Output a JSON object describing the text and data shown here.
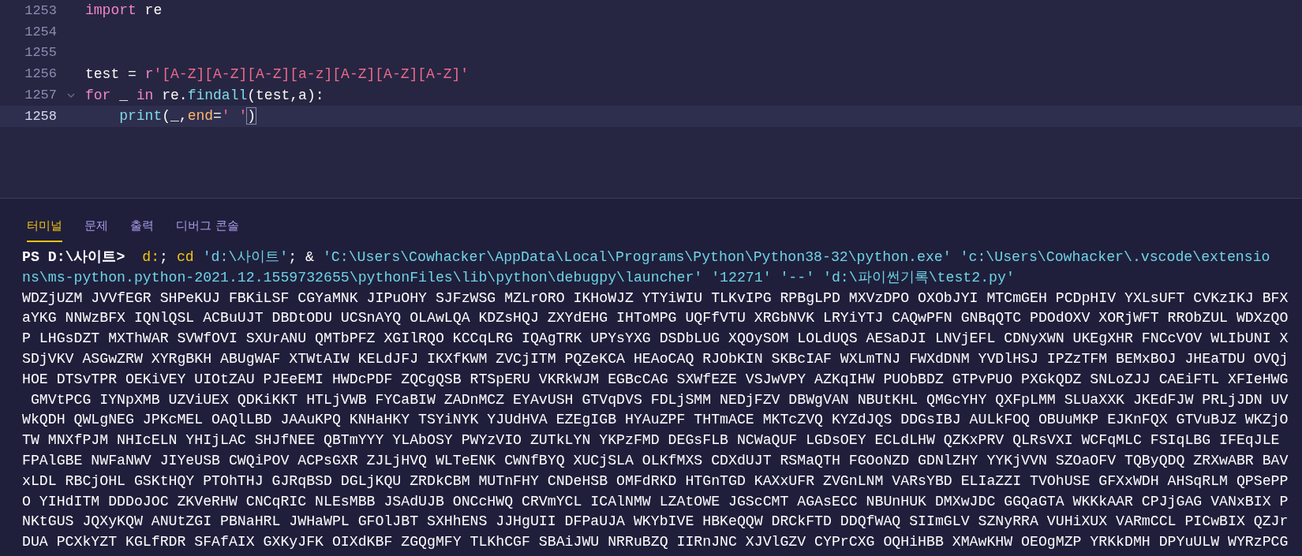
{
  "editor": {
    "lines": [
      {
        "number": "1253",
        "current": false,
        "tokens": [
          {
            "kind": "keyword",
            "text": "import"
          },
          {
            "kind": "plain",
            "text": " re"
          }
        ]
      },
      {
        "number": "1254",
        "current": false
      },
      {
        "number": "1255",
        "current": false
      },
      {
        "number": "1256",
        "current": false,
        "tokens": [
          {
            "kind": "plain",
            "text": "test = "
          },
          {
            "kind": "keyword",
            "text": "r"
          },
          {
            "kind": "string",
            "text": "'[A-Z][A-Z][A-Z][a-z][A-Z][A-Z][A-Z]'"
          }
        ]
      },
      {
        "number": "1257",
        "current": false,
        "foldable": true,
        "tokens": [
          {
            "kind": "keyword",
            "text": "for"
          },
          {
            "kind": "plain",
            "text": " _ "
          },
          {
            "kind": "keyword",
            "text": "in"
          },
          {
            "kind": "plain",
            "text": " re."
          },
          {
            "kind": "function",
            "text": "findall"
          },
          {
            "kind": "plain",
            "text": "(test,a):"
          }
        ]
      },
      {
        "number": "1258",
        "current": true,
        "indented": true,
        "tokens": [
          {
            "kind": "function",
            "text": "print"
          },
          {
            "kind": "plain",
            "text": "(_,"
          },
          {
            "kind": "param",
            "text": "end"
          },
          {
            "kind": "plain",
            "text": "="
          },
          {
            "kind": "string",
            "text": "' '"
          },
          {
            "kind": "match",
            "text": ")"
          }
        ]
      }
    ]
  },
  "panel": {
    "tabs": [
      {
        "label": "터미널",
        "selected": true
      },
      {
        "label": "문제",
        "selected": false
      },
      {
        "label": "출력",
        "selected": false
      },
      {
        "label": "디버그 콘솔",
        "selected": false
      }
    ],
    "lines": [
      {
        "segments": [
          {
            "kind": "prompt",
            "text": "PS D:\\사이트> "
          },
          {
            "kind": "command",
            "text": " d:"
          },
          {
            "kind": "plain",
            "text": "; "
          },
          {
            "kind": "command",
            "text": "cd"
          },
          {
            "kind": "string",
            "text": " 'd:\\사이트'"
          },
          {
            "kind": "plain",
            "text": "; & "
          },
          {
            "kind": "string",
            "text": "'C:\\Users\\Cowhacker\\AppData\\Local\\Programs\\Python\\Python38-32\\python.exe' 'c:\\Users\\Cowhacker\\.vscode\\extensio"
          }
        ]
      },
      {
        "segments": [
          {
            "kind": "string",
            "text": "ns\\ms-python.python-2021.12.1559732655\\pythonFiles\\lib\\python\\debugpy\\launcher' '12271' '--' 'd:\\파이썬기록\\test2.py'"
          }
        ]
      },
      {
        "segments": [
          {
            "kind": "plain",
            "text": "WDZjUZM JVVfEGR SHPeKUJ FBKiLSF CGYaMNK JIPuOHY SJFzWSG MZLrORO IKHoWJZ YTYiWIU TLKvIPG RPBgLPD MXVzDPO OXObJYI MTCmGEH PCDpHIV YXLsUFT CVKzIKJ BFX"
          }
        ]
      },
      {
        "segments": [
          {
            "kind": "plain",
            "text": "aYKG NNWzBFX IQNlQSL ACBuUJT DBDtODU UCSnAYQ OLAwLQA KDZsHQJ ZXYdEHG IHToMPG UQFfVTU XRGbNVK LRYiYTJ CAQwPFN GNBqQTC PDOdOXV XORjWFT RRObZUL WDXzQO"
          }
        ]
      },
      {
        "segments": [
          {
            "kind": "plain",
            "text": "P LHGsDZT MXThWAR SVWfOVI SXUrANU QMTbPFZ XGIlRQO KCCqLRG IQAgTRK UPYsYXG DSDbLUG XQOySOM LOLdUQS AESaDJI LNVjEFL CDNyXWN UKEgXHR FNCcVOV WLIbUNI X"
          }
        ]
      },
      {
        "segments": [
          {
            "kind": "plain",
            "text": "SDjVKV ASGwZRW XYRgBKH ABUgWAF XTWtAIW KELdJFJ IKXfKWM ZVCjITM PQZeKCA HEAoCAQ RJObKIN SKBcIAF WXLmTNJ FWXdDNM YVDlHSJ IPZzTFM BEMxBOJ JHEaTDU OVQj"
          }
        ]
      },
      {
        "segments": [
          {
            "kind": "plain",
            "text": "HOE DTSvTPR OEKiVEY UIOtZAU PJEeEMI HWDcPDF ZQCgQSB RTSpERU VKRkWJM EGBcCAG SXWfEZE VSJwVPY AZKqIHW PUObBDZ GTPvPUO PXGkQDZ SNLoZJJ CAEiFTL XFIeHWG"
          }
        ]
      },
      {
        "segments": [
          {
            "kind": "plain",
            "text": " GMVtPCG IYNpXMB UZViUEX QDKiKKT HTLjVWB FYCaBIW ZADnMCZ EYAvUSH GTVqDVS FDLjSMM NEDjFZV DBWgVAN NBUtKHL QMGcYHY QXFpLMM SLUaXXK JKEdFJW PRLjJDN UV"
          }
        ]
      },
      {
        "segments": [
          {
            "kind": "plain",
            "text": "WkQDH QWLgNEG JPKcMEL OAQlLBD JAAuKPQ KNHaHKY TSYiNYK YJUdHVA EZEgIGB HYAuZPF THTmACE MKTcZVQ KYZdJQS DDGsIBJ AULkFOQ OBUuMKP EJKnFQX GTVuBJZ WKZjO"
          }
        ]
      },
      {
        "segments": [
          {
            "kind": "plain",
            "text": "TW MNXfPJM NHIcELN YHIjLAC SHJfNEE QBTmYYY YLAbOSY PWYzVIO ZUTkLYN YKPzFMD DEGsFLB NCWaQUF LGDsOEY ECLdLHW QZKxPRV QLRsVXI WCFqMLC FSIqLBG IFEqJLE"
          }
        ]
      },
      {
        "segments": [
          {
            "kind": "plain",
            "text": "FPAlGBE NWFaNWV JIYeUSB CWQiPOV ACPsGXR ZJLjHVQ WLTeENK CWNfBYQ XUCjSLA OLKfMXS CDXdUJT RSMaQTH FGOoNZD GDNlZHY YYKjVVN SZOaOFV TQByQDQ ZRXwABR BAV"
          }
        ]
      },
      {
        "segments": [
          {
            "kind": "plain",
            "text": "xLDL RBCjOHL GSKtHQY PTOhTHJ GJRqBSD DGLjKQU ZRDkCBM MUTnFHY CNDeHSB OMFdRKD HTGnTGD KAXxUFR ZVGnLNM VARsYBD ELIaZZI TVOhUSE GFXxWDH AHSqRLM QPSePP"
          }
        ]
      },
      {
        "segments": [
          {
            "kind": "plain",
            "text": "O YIHdITM DDDoJOC ZKVeRHW CNCqRIC NLEsMBB JSAdUJB ONCcHWQ CRVmYCL ICAlNMW LZAtOWE JGScCMT AGAsECC NBUnHUK DMXwJDC GGQaGTA WKKkAAR CPJjGAG VANxBIX P"
          }
        ]
      },
      {
        "segments": [
          {
            "kind": "plain",
            "text": "NKtGUS JQXyKQW ANUtZGI PBNaHRL JWHaWPL GFOlJBT SXHhENS JJHgUII DFPaUJA WKYbIVE HBKeQQW DRCkFTD DDQfWAQ SIImGLV SZNyRRA VUHiXUX VARmCCL PICwBIX QZJr"
          }
        ]
      },
      {
        "segments": [
          {
            "kind": "plain",
            "text": "DUA PCXkYZT KGLfRDR SFAfAIX GXKyJFK OIXdKBF ZGQgMFY TLKhCGF SBAiJWU NRRuBZQ IIRnJNC XJVlGZV CYPrCXG OQHiHBB XMAwKHW OEOgMZP YRKkDMH DPYuULW WYRzPCG"
          }
        ]
      }
    ]
  }
}
